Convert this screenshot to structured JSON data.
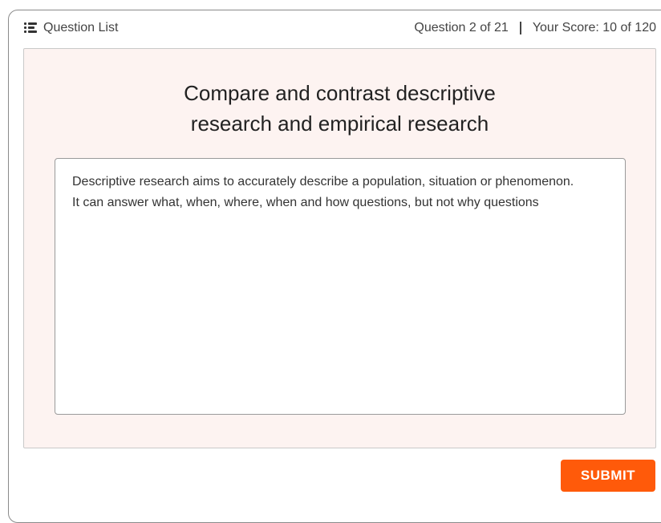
{
  "header": {
    "question_list_label": "Question List",
    "question_progress": "Question 2 of 21",
    "score": "Your Score: 10 of 120"
  },
  "question": {
    "line1": "Compare and contrast descriptive",
    "line2": "research and empirical research"
  },
  "answer": {
    "line1": "Descriptive research aims to accurately describe a population, situation or phenomenon.",
    "line2": "It can answer what, when, where, when and how questions, but not why questions"
  },
  "actions": {
    "submit_label": "SUBMIT"
  },
  "colors": {
    "panel_background": "#fdf3f1",
    "submit_button": "#ff5a0a"
  },
  "icons": {
    "question_list": "list-icon"
  }
}
